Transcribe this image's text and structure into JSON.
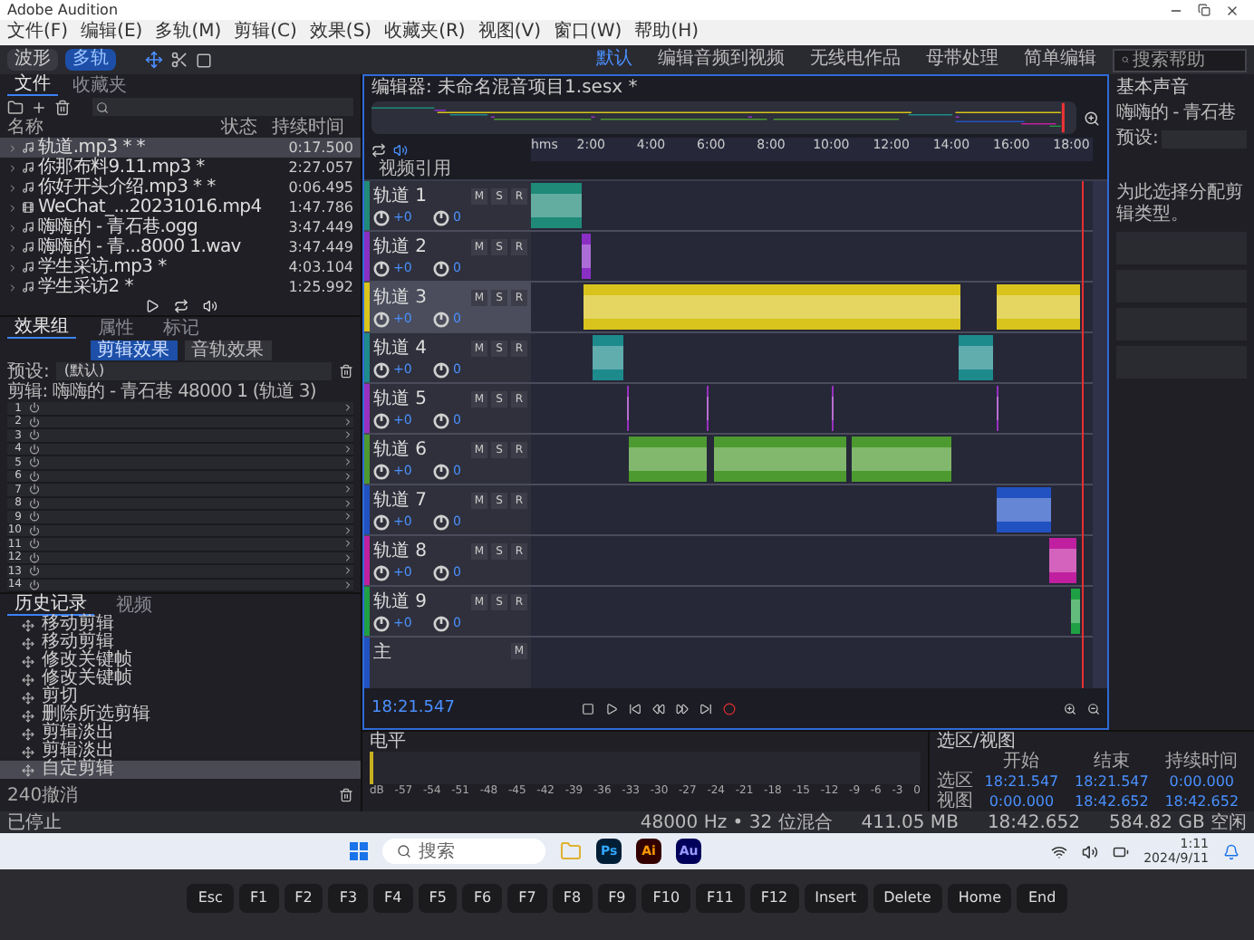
{
  "window": {
    "title": "Adobe Audition"
  },
  "menu": [
    "文件(F)",
    "编辑(E)",
    "多轨(M)",
    "剪辑(C)",
    "效果(S)",
    "收藏夹(R)",
    "视图(V)",
    "窗口(W)",
    "帮助(H)"
  ],
  "view_modes": [
    {
      "label": "波形",
      "selected": false
    },
    {
      "label": "多轨",
      "selected": true
    }
  ],
  "workspaces": [
    {
      "label": "默认",
      "selected": true
    },
    {
      "label": "编辑音频到视频",
      "selected": false
    },
    {
      "label": "无线电作品",
      "selected": false
    },
    {
      "label": "母带处理",
      "selected": false
    },
    {
      "label": "简单编辑",
      "selected": false
    }
  ],
  "search": {
    "placeholder": "搜索帮助"
  },
  "files_panel": {
    "tabs": [
      {
        "label": "文件",
        "selected": true
      },
      {
        "label": "收藏夹",
        "selected": false
      }
    ],
    "columns": [
      "名称",
      "状态",
      "持续时间"
    ],
    "rows": [
      {
        "name": "轨道.mp3 * *",
        "duration": "0:17.500",
        "kind": "audio",
        "selected": true
      },
      {
        "name": "你那布料9.11.mp3 *",
        "duration": "2:27.057",
        "kind": "audio",
        "selected": false
      },
      {
        "name": "你好开头介绍.mp3 * *",
        "duration": "0:06.495",
        "kind": "audio",
        "selected": false
      },
      {
        "name": "WeChat_...20231016.mp4",
        "duration": "1:47.786",
        "kind": "video",
        "selected": false
      },
      {
        "name": "嗨嗨的 - 青石巷.ogg",
        "duration": "3:47.449",
        "kind": "audio",
        "selected": false
      },
      {
        "name": "嗨嗨的 - 青...8000 1.wav",
        "duration": "3:47.449",
        "kind": "audio",
        "selected": false
      },
      {
        "name": "学生采访.mp3 *",
        "duration": "4:03.104",
        "kind": "audio",
        "selected": false
      },
      {
        "name": "学生采访2 *",
        "duration": "1:25.992",
        "kind": "audio",
        "selected": false
      }
    ]
  },
  "effects_panel": {
    "tabs": [
      {
        "label": "效果组",
        "selected": true
      },
      {
        "label": "属性",
        "selected": false
      },
      {
        "label": "标记",
        "selected": false
      }
    ],
    "modes": [
      {
        "label": "剪辑效果",
        "selected": true
      },
      {
        "label": "音轨效果",
        "selected": false
      }
    ],
    "preset_label": "预设:",
    "preset": "(默认)",
    "clip": "剪辑: 嗨嗨的 - 青石巷 48000 1 (轨道 3)",
    "slots": [
      "1",
      "2",
      "3",
      "4",
      "5",
      "6",
      "7",
      "8",
      "9",
      "10",
      "11",
      "12",
      "13",
      "14"
    ]
  },
  "history_panel": {
    "tabs": [
      {
        "label": "历史记录",
        "selected": true
      },
      {
        "label": "视频",
        "selected": false
      }
    ],
    "items": [
      {
        "label": "移动剪辑",
        "selected": false
      },
      {
        "label": "移动剪辑",
        "selected": false
      },
      {
        "label": "修改关键帧",
        "selected": false
      },
      {
        "label": "修改关键帧",
        "selected": false
      },
      {
        "label": "剪切",
        "selected": false
      },
      {
        "label": "删除所选剪辑",
        "selected": false
      },
      {
        "label": "剪辑淡出",
        "selected": false
      },
      {
        "label": "剪辑淡出",
        "selected": false
      },
      {
        "label": "自定剪辑",
        "selected": true
      }
    ],
    "undo_count": "240撤消"
  },
  "editor": {
    "title": "编辑器: 未命名混音项目1.sesx *",
    "ruler": [
      "hms",
      "2:00",
      "4:00",
      "6:00",
      "8:00",
      "10:00",
      "12:00",
      "14:00",
      "16:00",
      "18:00"
    ],
    "video_track": "视频引用",
    "tracks": [
      {
        "name": "轨道 1",
        "color": "#1f8a78",
        "selected": false,
        "buttons": [
          "M",
          "S",
          "R"
        ],
        "volume": "+0",
        "pan": "0"
      },
      {
        "name": "轨道 2",
        "color": "#8a2fc4",
        "selected": false,
        "buttons": [
          "M",
          "S",
          "R"
        ],
        "volume": "+0",
        "pan": "0"
      },
      {
        "name": "轨道 3",
        "color": "#d8c41c",
        "selected": true,
        "buttons": [
          "M",
          "S",
          "R"
        ],
        "volume": "+0",
        "pan": "0"
      },
      {
        "name": "轨道 4",
        "color": "#1d8a8c",
        "selected": false,
        "buttons": [
          "M",
          "S",
          "R"
        ],
        "volume": "+0",
        "pan": "0"
      },
      {
        "name": "轨道 5",
        "color": "#9a30c0",
        "selected": false,
        "buttons": [
          "M",
          "S",
          "R"
        ],
        "volume": "+0",
        "pan": "0"
      },
      {
        "name": "轨道 6",
        "color": "#4c9a30",
        "selected": false,
        "buttons": [
          "M",
          "S",
          "R"
        ],
        "volume": "+0",
        "pan": "0"
      },
      {
        "name": "轨道 7",
        "color": "#2252c2",
        "selected": false,
        "buttons": [
          "M",
          "S",
          "R"
        ],
        "volume": "+0",
        "pan": "0"
      },
      {
        "name": "轨道 8",
        "color": "#c020a0",
        "selected": false,
        "buttons": [
          "M",
          "S",
          "R"
        ],
        "volume": "+0",
        "pan": "0"
      },
      {
        "name": "轨道 9",
        "color": "#20a044",
        "selected": false,
        "buttons": [
          "M",
          "S",
          "R"
        ],
        "volume": "+0",
        "pan": "0"
      }
    ],
    "master": {
      "name": "主",
      "color": "#2252c2",
      "buttons": [
        "M"
      ]
    },
    "time": "18:21.547"
  },
  "basic_sound": {
    "title": "基本声音",
    "clip": "嗨嗨的 - 青石巷",
    "preset_label": "预设:",
    "hint": "为此选择分配剪辑类型。"
  },
  "level_panel": {
    "title": "电平",
    "scale": [
      "dB",
      "-57",
      "-54",
      "-51",
      "-48",
      "-45",
      "-42",
      "-39",
      "-36",
      "-33",
      "-30",
      "-27",
      "-24",
      "-21",
      "-18",
      "-15",
      "-12",
      "-9",
      "-6",
      "-3",
      "0"
    ]
  },
  "selection_view": {
    "title": "选区/视图",
    "columns": [
      "开始",
      "结束",
      "持续时间"
    ],
    "rows": [
      {
        "label": "选区",
        "values": [
          "18:21.547",
          "18:21.547",
          "0:00.000"
        ]
      },
      {
        "label": "视图",
        "values": [
          "0:00.000",
          "18:42.652",
          "18:42.652"
        ]
      }
    ]
  },
  "status_bar": {
    "state": "已停止",
    "items": [
      "48000 Hz • 32 位混合",
      "411.05 MB",
      "18:42.652",
      "584.82 GB 空闲"
    ]
  },
  "taskbar": {
    "search_placeholder": "搜索",
    "apps": [
      "Ps",
      "Ai",
      "Au"
    ],
    "time": "1:11",
    "date": "2024/9/11"
  },
  "keyboard": [
    "Esc",
    "F1",
    "F2",
    "F3",
    "F4",
    "F5",
    "F6",
    "F7",
    "F8",
    "F9",
    "F10",
    "F11",
    "F12",
    "Insert",
    "Delete",
    "Home",
    "End"
  ]
}
